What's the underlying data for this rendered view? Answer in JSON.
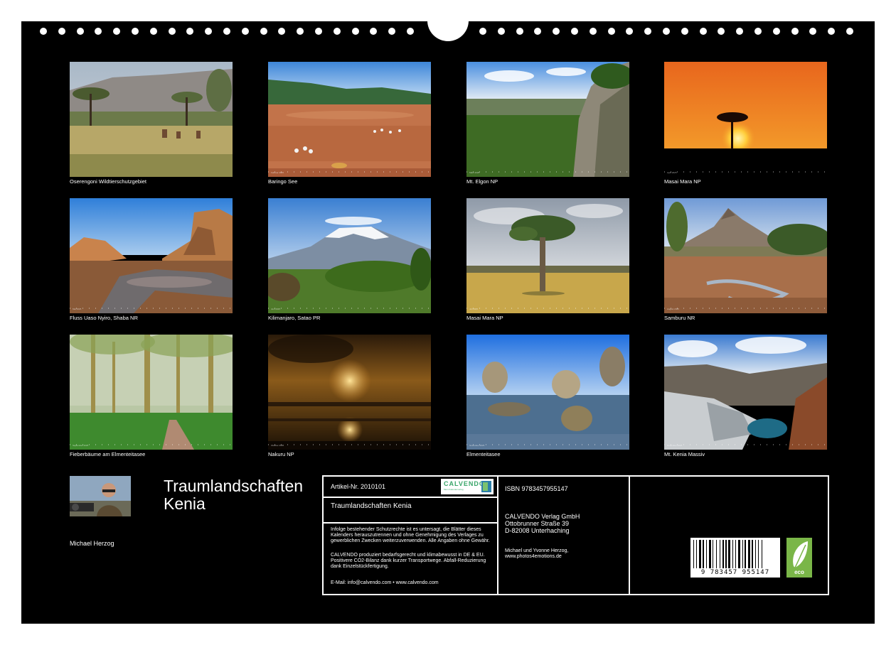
{
  "photos": [
    {
      "caption": "Oserengoni Wildtierschutzgebiet",
      "strip_label": ""
    },
    {
      "caption": "Baringo See",
      "strip_label": "Februar 2025"
    },
    {
      "caption": "Mt. Elgon NP",
      "strip_label": "März 2025"
    },
    {
      "caption": "Masai Mara NP",
      "strip_label": "April 2025"
    },
    {
      "caption": "Fluss Uaso Nyiro, Shaba NR",
      "strip_label": "Mai 2025"
    },
    {
      "caption": "Kilimanjaro, Satao PR",
      "strip_label": "Juni 2025"
    },
    {
      "caption": "Masai Mara NP",
      "strip_label": "Juli 2025"
    },
    {
      "caption": "Samburu NR",
      "strip_label": "August 2025"
    },
    {
      "caption": "Fieberbäume am Elmenteitasee",
      "strip_label": "September 2025"
    },
    {
      "caption": "Nakuru NP",
      "strip_label": "Oktober 2025"
    },
    {
      "caption": "Elmenteitasee",
      "strip_label": "November 2025"
    },
    {
      "caption": "Mt. Kenia Massiv",
      "strip_label": "Dezember 2025"
    }
  ],
  "author": {
    "name": "Michael Herzog"
  },
  "title": {
    "line1": "Traumlandschaften",
    "line2": "Kenia"
  },
  "info": {
    "article": "Artikel-Nr. 2010101",
    "logo": "CALVENDO",
    "logo_sub": "Mein Kalenderverlag",
    "subtitle": "Traumlandschaften Kenia",
    "legal": "Infolge bestehender Schutzrechte ist es untersagt, die Blätter dieses Kalenders herauszutrennen und ohne Genehmigung des Verlages zu gewerblichen Zwecken weiterzuverwenden. Alle Angaben ohne Gewähr.",
    "eco_note": "CALVENDO produziert bedarfsgerecht und klimabewusst in DE & EU. Positivere CO2-Bilanz dank kurzer Transportwege. Abfall-Reduzierung dank Einzelstückfertigung.",
    "contact": "E-Mail: info@calvendo.com • www.calvendo.com",
    "isbn": "ISBN 9783457955147",
    "publisher_name": "CALVENDO Verlag GmbH",
    "publisher_street": "Ottobrunner Straße 39",
    "publisher_city": "D-82008 Unterhaching",
    "authors": "Michael und Yvonne Herzog,",
    "website": "www.photos4emotions.de",
    "barcode_digits": "9 783457 955147",
    "eco_label": "eco"
  },
  "colors": {
    "background": "#000000",
    "page": "#ffffff",
    "eco_green": "#7ab648",
    "logo_green": "#3aa66a"
  }
}
